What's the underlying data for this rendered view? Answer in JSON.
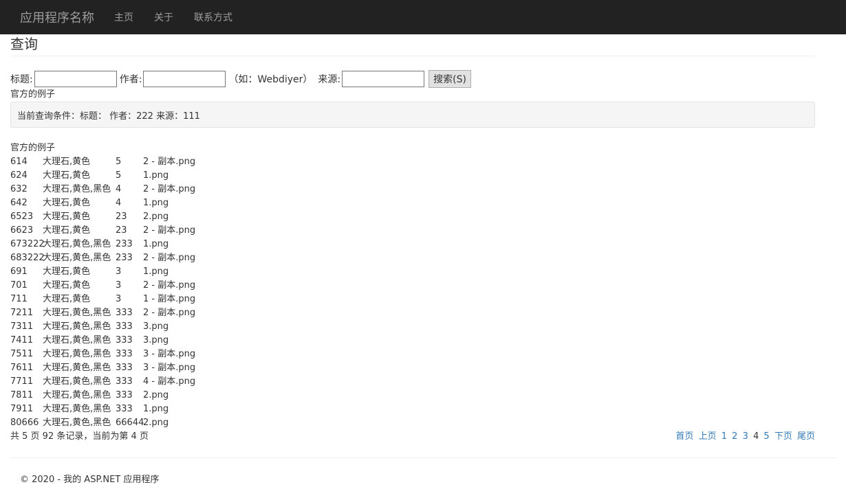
{
  "nav": {
    "brand": "应用程序名称",
    "links": [
      "主页",
      "关于",
      "联系方式"
    ]
  },
  "page": {
    "title": "查询"
  },
  "search": {
    "title_label": "标题:",
    "author_label": "作者:",
    "author_hint": "（如：Webdiyer）",
    "source_label": "来源:",
    "title_value": "",
    "author_value": "",
    "source_value": "",
    "button_label": "搜索(S)"
  },
  "example_label_1": "官方的例子",
  "current_conditions": "当前查询条件：标题：  作者：222  来源：111",
  "example_label_2": "官方的例子",
  "records": [
    [
      "614",
      "大理石,黄色",
      "5",
      "2 - 副本.png"
    ],
    [
      "624",
      "大理石,黄色",
      "5",
      "1.png"
    ],
    [
      "632",
      "大理石,黄色,黑色",
      "4",
      "2 - 副本.png"
    ],
    [
      "642",
      "大理石,黄色",
      "4",
      "1.png"
    ],
    [
      "6523",
      "大理石,黄色",
      "23",
      "2.png"
    ],
    [
      "6623",
      "大理石,黄色",
      "23",
      "2 - 副本.png"
    ],
    [
      "673222",
      "大理石,黄色,黑色",
      "233",
      "1.png"
    ],
    [
      "683222",
      "大理石,黄色,黑色",
      "233",
      "2 - 副本.png"
    ],
    [
      "691",
      "大理石,黄色",
      "3",
      "1.png"
    ],
    [
      "701",
      "大理石,黄色",
      "3",
      "2 - 副本.png"
    ],
    [
      "711",
      "大理石,黄色",
      "3",
      "1 - 副本.png"
    ],
    [
      "7211",
      "大理石,黄色,黑色",
      "333",
      "2 - 副本.png"
    ],
    [
      "7311",
      "大理石,黄色,黑色",
      "333",
      "3.png"
    ],
    [
      "7411",
      "大理石,黄色,黑色",
      "333",
      "3.png"
    ],
    [
      "7511",
      "大理石,黄色,黑色",
      "333",
      "3 - 副本.png"
    ],
    [
      "7611",
      "大理石,黄色,黑色",
      "333",
      "3 - 副本.png"
    ],
    [
      "7711",
      "大理石,黄色,黑色",
      "333",
      "4 - 副本.png"
    ],
    [
      "7811",
      "大理石,黄色,黑色",
      "333",
      "2.png"
    ],
    [
      "7911",
      "大理石,黄色,黑色",
      "333",
      "1.png"
    ],
    [
      "80666",
      "大理石,黄色,黑色",
      "66644",
      "2.png"
    ]
  ],
  "summary": "共 5 页 92 条记录，当前为第 4 页",
  "pager": {
    "first": "首页",
    "prev": "上页",
    "pages": [
      "1",
      "2",
      "3",
      "4",
      "5"
    ],
    "current_page": "4",
    "next": "下页",
    "last": "尾页"
  },
  "footer": "© 2020 - 我的 ASP.NET 应用程序",
  "colors": {
    "navbar_bg": "#222222",
    "link": "#337ab7"
  }
}
